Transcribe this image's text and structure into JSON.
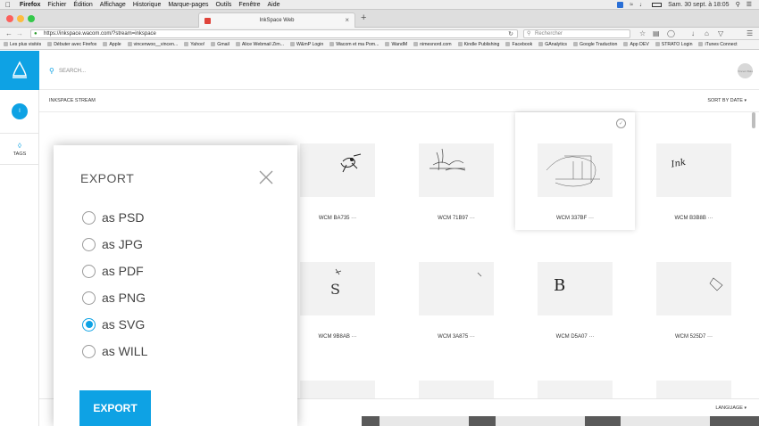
{
  "menubar": {
    "items": [
      "Firefox",
      "Fichier",
      "Édition",
      "Affichage",
      "Historique",
      "Marque-pages",
      "Outils",
      "Fenêtre",
      "Aide"
    ],
    "clock": "Sam. 30 sept. à 18:05"
  },
  "browser": {
    "tab_title": "InkSpace Web",
    "url": "https://inkspace.wacom.com/?stream=inkspace",
    "search_placeholder": "Rechercher"
  },
  "bookmarks": [
    "Les plus visités",
    "Débuter avec Firefox",
    "Apple",
    "vincenwoo__vincen...",
    "Yahoo!",
    "Gmail",
    "Alice Webmail Zim...",
    "W&mP Login",
    "Wacom et ma Pom...",
    "WandM",
    "nimesnord.com",
    "Kindle Publishing",
    "Facebook",
    "GAnalytics",
    "Google Traduction",
    "App DEV",
    "STRATO Login",
    "iTunes Connect"
  ],
  "app": {
    "search_placeholder": "SEARCH...",
    "sidebar_avatar": "I",
    "tags_label": "TAGS",
    "user_avatar_text": "Vincent Bala",
    "stream_title": "INKSPACE STREAM",
    "sort_label": "SORT BY DATE",
    "language_label": "LANGUAGE",
    "accent_color": "#0ea2e4"
  },
  "cards": [
    {
      "label": "WCM BA735"
    },
    {
      "label": "WCM 71B97"
    },
    {
      "label": "WCM 337BF"
    },
    {
      "label": "WCM B3B8B"
    },
    {
      "label": "WCM 9B8AB"
    },
    {
      "label": "WCM 3A875"
    },
    {
      "label": "WCM D5A07"
    },
    {
      "label": "WCM 525D7"
    }
  ],
  "modal": {
    "title": "EXPORT",
    "options": [
      {
        "label": "as PSD",
        "selected": false
      },
      {
        "label": "as JPG",
        "selected": false
      },
      {
        "label": "as PDF",
        "selected": false
      },
      {
        "label": "as PNG",
        "selected": false
      },
      {
        "label": "as SVG",
        "selected": true
      },
      {
        "label": "as WILL",
        "selected": false
      }
    ],
    "button_label": "EXPORT"
  }
}
